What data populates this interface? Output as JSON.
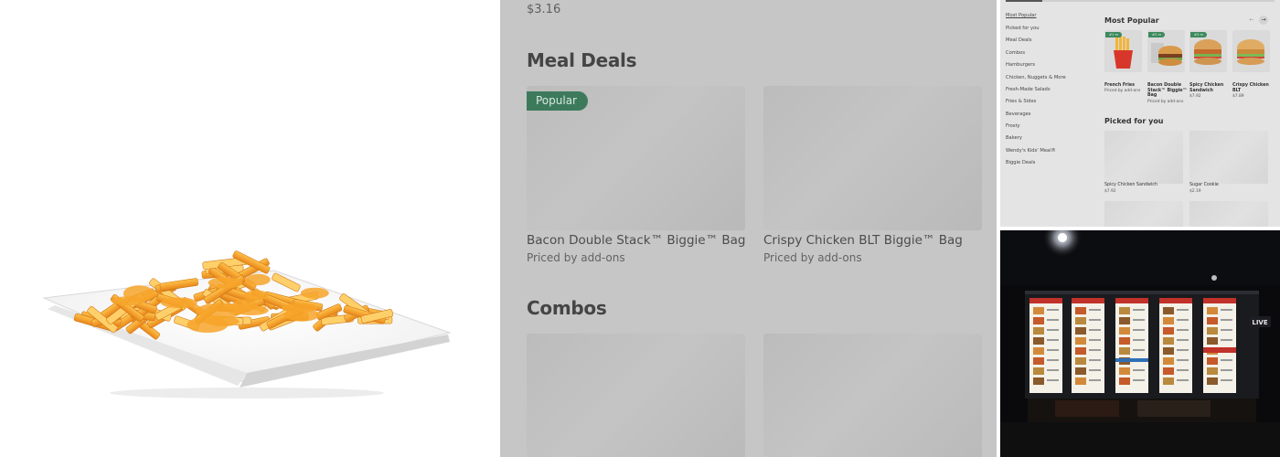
{
  "product_photo": {
    "alt": "Cheese fries on a white plate"
  },
  "menu": {
    "top_price": "$3.16",
    "sections": [
      {
        "title": "Meal Deals",
        "items": [
          {
            "badge": "Popular",
            "title": "Bacon Double Stack™ Biggie™ Bag",
            "subtitle": "Priced by add-ons"
          },
          {
            "title": "Crispy Chicken BLT Biggie™ Bag",
            "subtitle": "Priced by add-ons"
          }
        ]
      },
      {
        "title": "Combos"
      }
    ]
  },
  "thumbnail": {
    "nav_items": [
      "Most Popular",
      "Picked for you",
      "Meal Deals",
      "Combos",
      "Hamburgers",
      "Chicken, Nuggets & More",
      "Fresh-Made Salads",
      "Fries & Sides",
      "Beverages",
      "Frosty",
      "Bakery",
      "Wendy's Kids' Meal®",
      "Biggie Deals"
    ],
    "most_popular": {
      "title": "Most Popular",
      "items": [
        {
          "badge": "#1 m",
          "name": "French Fries",
          "sub": "Priced by add-ons"
        },
        {
          "badge": "#2 m",
          "name": "Bacon Double Stack™ Biggie™ Bag",
          "sub": "Priced by add-ons"
        },
        {
          "badge": "#3 m",
          "name": "Spicy Chicken Sandwich",
          "sub": "$7.92"
        },
        {
          "name": "Crispy Chicken BLT",
          "sub": "$7.89"
        }
      ]
    },
    "picked_for_you": {
      "title": "Picked for you",
      "items": [
        {
          "name": "Spicy Chicken Sandwich",
          "price": "$7.92"
        },
        {
          "name": "Sugar Cookie",
          "price": "$2.19"
        }
      ]
    }
  },
  "night_photo": {
    "sign_text": "LIVE"
  },
  "colors": {
    "menu_overlay": "#c6c6c6",
    "badge_green": "#3d7a5c",
    "thumbnail_bg": "#e4e4e4",
    "night_bg": "#0a0a0c"
  }
}
